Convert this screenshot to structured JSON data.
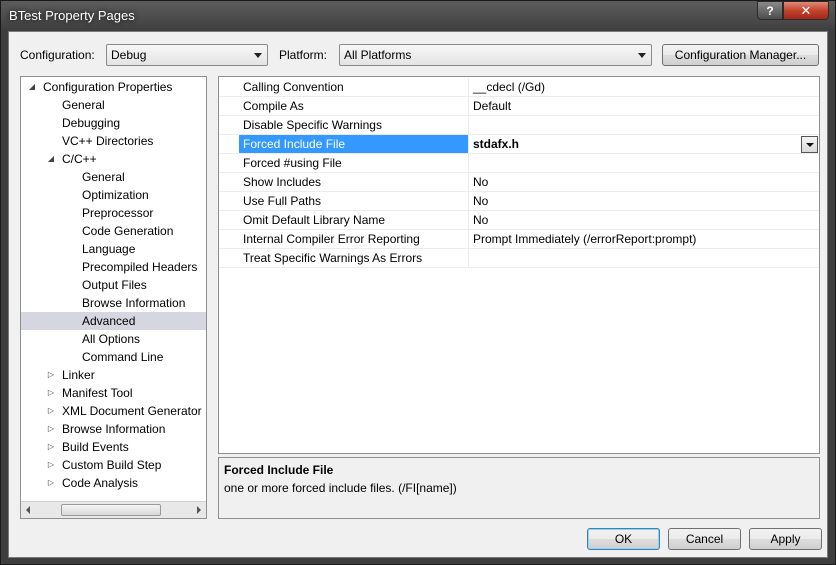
{
  "window": {
    "title": "BTest Property Pages",
    "help_label": "?",
    "close_label": "✕"
  },
  "top_bar": {
    "configuration_label": "Configuration:",
    "configuration_value": "Debug",
    "platform_label": "Platform:",
    "platform_value": "All Platforms",
    "config_manager_label": "Configuration Manager..."
  },
  "tree": {
    "items": [
      {
        "label": "Configuration Properties",
        "level": 0,
        "expander": "expanded"
      },
      {
        "label": "General",
        "level": 1,
        "expander": "none"
      },
      {
        "label": "Debugging",
        "level": 1,
        "expander": "none"
      },
      {
        "label": "VC++ Directories",
        "level": 1,
        "expander": "none"
      },
      {
        "label": "C/C++",
        "level": 1,
        "expander": "expanded"
      },
      {
        "label": "General",
        "level": 2,
        "expander": "none"
      },
      {
        "label": "Optimization",
        "level": 2,
        "expander": "none"
      },
      {
        "label": "Preprocessor",
        "level": 2,
        "expander": "none"
      },
      {
        "label": "Code Generation",
        "level": 2,
        "expander": "none"
      },
      {
        "label": "Language",
        "level": 2,
        "expander": "none"
      },
      {
        "label": "Precompiled Headers",
        "level": 2,
        "expander": "none"
      },
      {
        "label": "Output Files",
        "level": 2,
        "expander": "none"
      },
      {
        "label": "Browse Information",
        "level": 2,
        "expander": "none"
      },
      {
        "label": "Advanced",
        "level": 2,
        "expander": "none",
        "selected": true
      },
      {
        "label": "All Options",
        "level": 2,
        "expander": "none"
      },
      {
        "label": "Command Line",
        "level": 2,
        "expander": "none"
      },
      {
        "label": "Linker",
        "level": 1,
        "expander": "collapsed"
      },
      {
        "label": "Manifest Tool",
        "level": 1,
        "expander": "collapsed"
      },
      {
        "label": "XML Document Generator",
        "level": 1,
        "expander": "collapsed"
      },
      {
        "label": "Browse Information",
        "level": 1,
        "expander": "collapsed"
      },
      {
        "label": "Build Events",
        "level": 1,
        "expander": "collapsed"
      },
      {
        "label": "Custom Build Step",
        "level": 1,
        "expander": "collapsed"
      },
      {
        "label": "Code Analysis",
        "level": 1,
        "expander": "collapsed"
      }
    ]
  },
  "properties": [
    {
      "name": "Calling Convention",
      "value": "__cdecl (/Gd)"
    },
    {
      "name": "Compile As",
      "value": "Default"
    },
    {
      "name": "Disable Specific Warnings",
      "value": ""
    },
    {
      "name": "Forced Include File",
      "value": "stdafx.h",
      "selected": true
    },
    {
      "name": "Forced #using File",
      "value": ""
    },
    {
      "name": "Show Includes",
      "value": "No"
    },
    {
      "name": "Use Full Paths",
      "value": "No"
    },
    {
      "name": "Omit Default Library Name",
      "value": "No"
    },
    {
      "name": "Internal Compiler Error Reporting",
      "value": "Prompt Immediately (/errorReport:prompt)"
    },
    {
      "name": "Treat Specific Warnings As Errors",
      "value": ""
    }
  ],
  "description": {
    "title": "Forced Include File",
    "text": "one or more forced include files.     (/FI[name])"
  },
  "buttons": {
    "ok": "OK",
    "cancel": "Cancel",
    "apply": "Apply"
  }
}
